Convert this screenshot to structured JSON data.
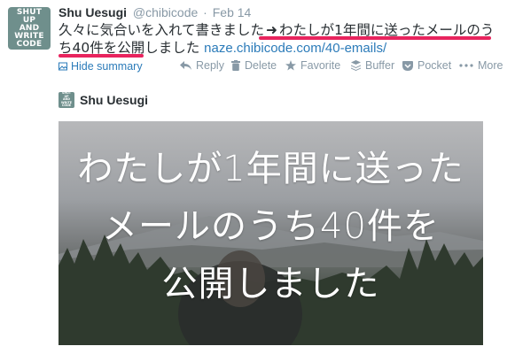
{
  "tweet": {
    "avatar_lines": [
      "SHUT",
      "UP",
      "AND",
      "WRITE",
      "CODE"
    ],
    "name": "Shu Uesugi",
    "handle": "@chibicode",
    "separator": "·",
    "date": "Feb 14",
    "text_before": "久々に気合いを入れて書きました",
    "arrow": "➜",
    "text_highlight": "わたしが1年間に送ったメールのうち40件を公開しました",
    "link": "naze.chibicode.com/40-emails/"
  },
  "summary_toggle": {
    "label": "Hide summary",
    "icon": "image-icon"
  },
  "actions": [
    {
      "label": "Reply",
      "icon": "reply-icon"
    },
    {
      "label": "Delete",
      "icon": "trash-icon"
    },
    {
      "label": "Favorite",
      "icon": "star-icon"
    },
    {
      "label": "Buffer",
      "icon": "buffer-icon"
    },
    {
      "label": "Pocket",
      "icon": "pocket-icon"
    },
    {
      "label": "More",
      "icon": "more-icon"
    }
  ],
  "card": {
    "author": "Shu Uesugi",
    "mini_avatar_lines": [
      "SHUT",
      "UP",
      "AND",
      "WRITE",
      "CODE"
    ],
    "title_lines": [
      "わたしが1年間に送った",
      "メールのうち40件を",
      "公開しました"
    ]
  },
  "colors": {
    "link": "#2b7bb9",
    "highlight_underline": "#e8245e",
    "muted": "#8899a6",
    "avatar_bg": "#6f8f8c"
  }
}
